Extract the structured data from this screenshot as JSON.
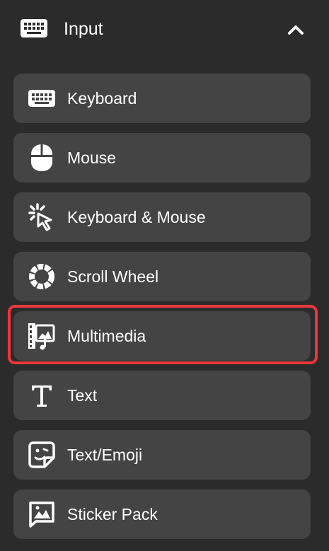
{
  "header": {
    "title": "Input",
    "icon": "keyboard-icon",
    "toggle_icon": "chevron-up-icon"
  },
  "items": [
    {
      "label": "Keyboard",
      "icon": "keyboard-icon"
    },
    {
      "label": "Mouse",
      "icon": "mouse-icon"
    },
    {
      "label": "Keyboard & Mouse",
      "icon": "click-cursor-icon"
    },
    {
      "label": "Scroll Wheel",
      "icon": "scroll-wheel-icon"
    },
    {
      "label": "Multimedia",
      "icon": "multimedia-icon"
    },
    {
      "label": "Text",
      "icon": "text-icon"
    },
    {
      "label": "Text/Emoji",
      "icon": "emoji-sticker-icon"
    },
    {
      "label": "Sticker Pack",
      "icon": "image-message-icon"
    }
  ],
  "colors": {
    "background": "#2b2b2b",
    "item": "#444444",
    "highlight": "#e8373d"
  }
}
